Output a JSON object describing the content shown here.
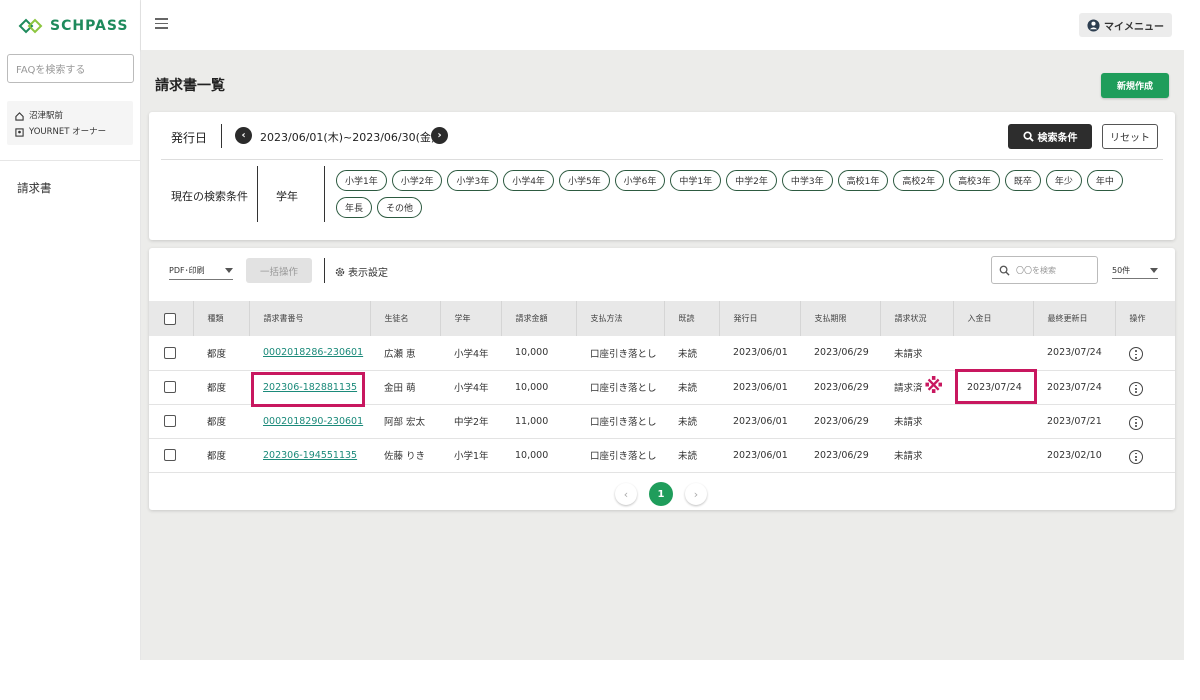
{
  "app": {
    "logo_text": "SCHPASS"
  },
  "sidebar": {
    "faq_placeholder": "FAQを検索する",
    "school_name": "沼津駅前",
    "user_name": "YOURNET オーナー",
    "nav_invoice": "請求書"
  },
  "header": {
    "mymenu_label": "マイメニュー"
  },
  "page": {
    "title": "請求書一覧",
    "new_button": "新規作成"
  },
  "filter": {
    "issue_date_label": "発行日",
    "date_range": "2023/06/01(木)~2023/06/30(金)",
    "search_button": "検索条件",
    "reset_button": "リセット",
    "current_conditions_label": "現在の検索条件",
    "grade_label": "学年",
    "chips": [
      "小学1年",
      "小学2年",
      "小学3年",
      "小学4年",
      "小学5年",
      "小学6年",
      "中学1年",
      "中学2年",
      "中学3年",
      "高校1年",
      "高校2年",
      "高校3年",
      "既卒",
      "年少",
      "年中",
      "年長",
      "その他"
    ]
  },
  "toolbar": {
    "pdf_select": "PDF･印刷",
    "bulk_button": "一括操作",
    "display_settings": "表示設定",
    "search_placeholder": "〇〇を検索",
    "per_page": "50件"
  },
  "table": {
    "headers": [
      "種類",
      "請求書番号",
      "生徒名",
      "学年",
      "請求金額",
      "支払方法",
      "既読",
      "発行日",
      "支払期限",
      "請求状況",
      "入金日",
      "最終更新日",
      "操作"
    ],
    "rows": [
      {
        "type": "都度",
        "number": "0002018286-230601",
        "student": "広瀬 恵",
        "grade": "小学4年",
        "amount": "10,000",
        "method": "口座引き落とし",
        "read": "未読",
        "issued": "2023/06/01",
        "due": "2023/06/29",
        "status": "未請求",
        "paid": "",
        "updated": "2023/07/24"
      },
      {
        "type": "都度",
        "number": "202306-182881135",
        "student": "金田 萌",
        "grade": "小学4年",
        "amount": "10,000",
        "method": "口座引き落とし",
        "read": "未読",
        "issued": "2023/06/01",
        "due": "2023/06/29",
        "status": "請求済",
        "paid": "2023/07/24",
        "updated": "2023/07/24"
      },
      {
        "type": "都度",
        "number": "0002018290-230601",
        "student": "阿部 宏太",
        "grade": "中学2年",
        "amount": "11,000",
        "method": "口座引き落とし",
        "read": "未読",
        "issued": "2023/06/01",
        "due": "2023/06/29",
        "status": "未請求",
        "paid": "",
        "updated": "2023/07/21"
      },
      {
        "type": "都度",
        "number": "202306-194551135",
        "student": "佐藤 りき",
        "grade": "小学1年",
        "amount": "10,000",
        "method": "口座引き落とし",
        "read": "未読",
        "issued": "2023/06/01",
        "due": "2023/06/29",
        "status": "未請求",
        "paid": "",
        "updated": "2023/02/10"
      }
    ]
  },
  "pagination": {
    "current_page": "1"
  },
  "annotations": {
    "cross_mark": "※",
    "highlight_color": "#c8175f"
  },
  "colors": {
    "brand_green": "#1f9d5b",
    "link": "#1b8a7a"
  }
}
